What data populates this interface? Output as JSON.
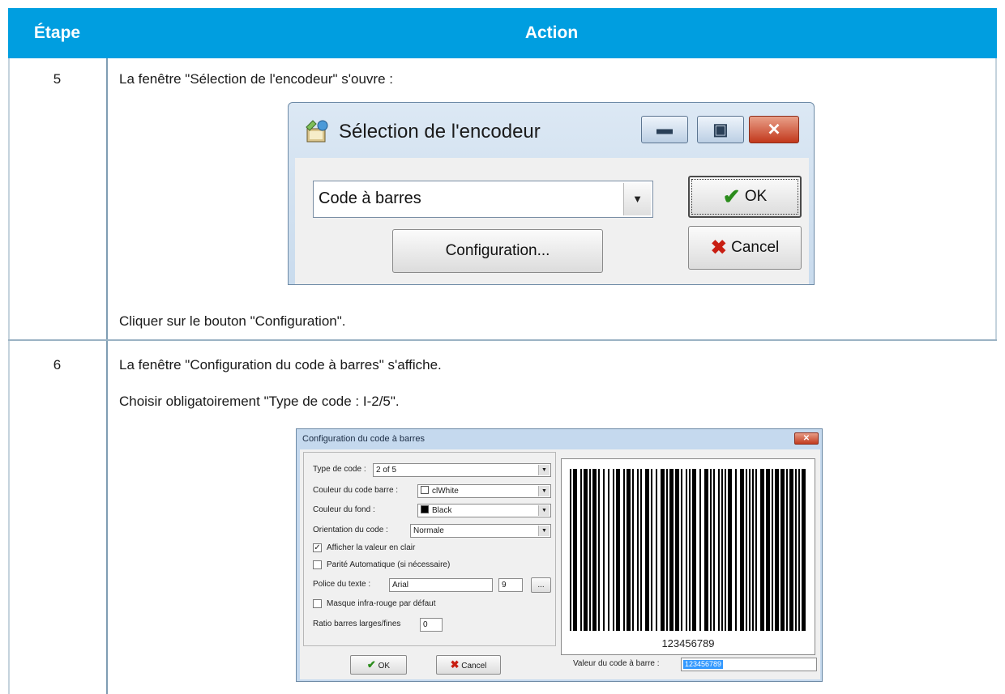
{
  "table": {
    "header": {
      "step": "Étape",
      "action": "Action"
    },
    "rows": [
      {
        "step": "5",
        "text_before": "La fenêtre \"Sélection de l'encodeur\" s'ouvre :",
        "text_after": "Cliquer sur le bouton \"Configuration\"."
      },
      {
        "step": "6",
        "text_1": "La fenêtre \"Configuration du code à barres\" s'affiche.",
        "text_2": "Choisir obligatoirement \"Type de code : I-2/5\"."
      }
    ]
  },
  "encoder_window": {
    "title": "Sélection de l'encodeur",
    "selected_encoder": "Code à barres",
    "ok_label": "OK",
    "configuration_label": "Configuration...",
    "cancel_label": "Cancel"
  },
  "barcode_window": {
    "title": "Configuration du code à barres",
    "type_label": "Type de code :",
    "type_value": "2 of 5",
    "bar_color_label": "Couleur du code barre :",
    "bar_color_value": "clWhite",
    "bg_color_label": "Couleur du fond :",
    "bg_color_value": "Black",
    "orientation_label": "Orientation du code :",
    "orientation_value": "Normale",
    "show_value_label": "Afficher la valeur en clair",
    "show_value_checked": true,
    "parity_label": "Parité Automatique (si nécessaire)",
    "parity_checked": false,
    "font_label": "Police du texte :",
    "font_value": "Arial",
    "font_size": "9",
    "font_button": "...",
    "ir_mask_label": "Masque infra-rouge par défaut",
    "ir_mask_checked": false,
    "ratio_label": "Ratio barres larges/fines",
    "ratio_value": "0",
    "barcode_text": "123456789",
    "value_label": "Valeur du code à barre :",
    "value": "123456789",
    "ok_label": "OK",
    "cancel_label": "Cancel"
  },
  "colors": {
    "header_bg": "#009ee0",
    "ok_check": "#2b8c1c",
    "cancel_cross": "#c81e12"
  }
}
